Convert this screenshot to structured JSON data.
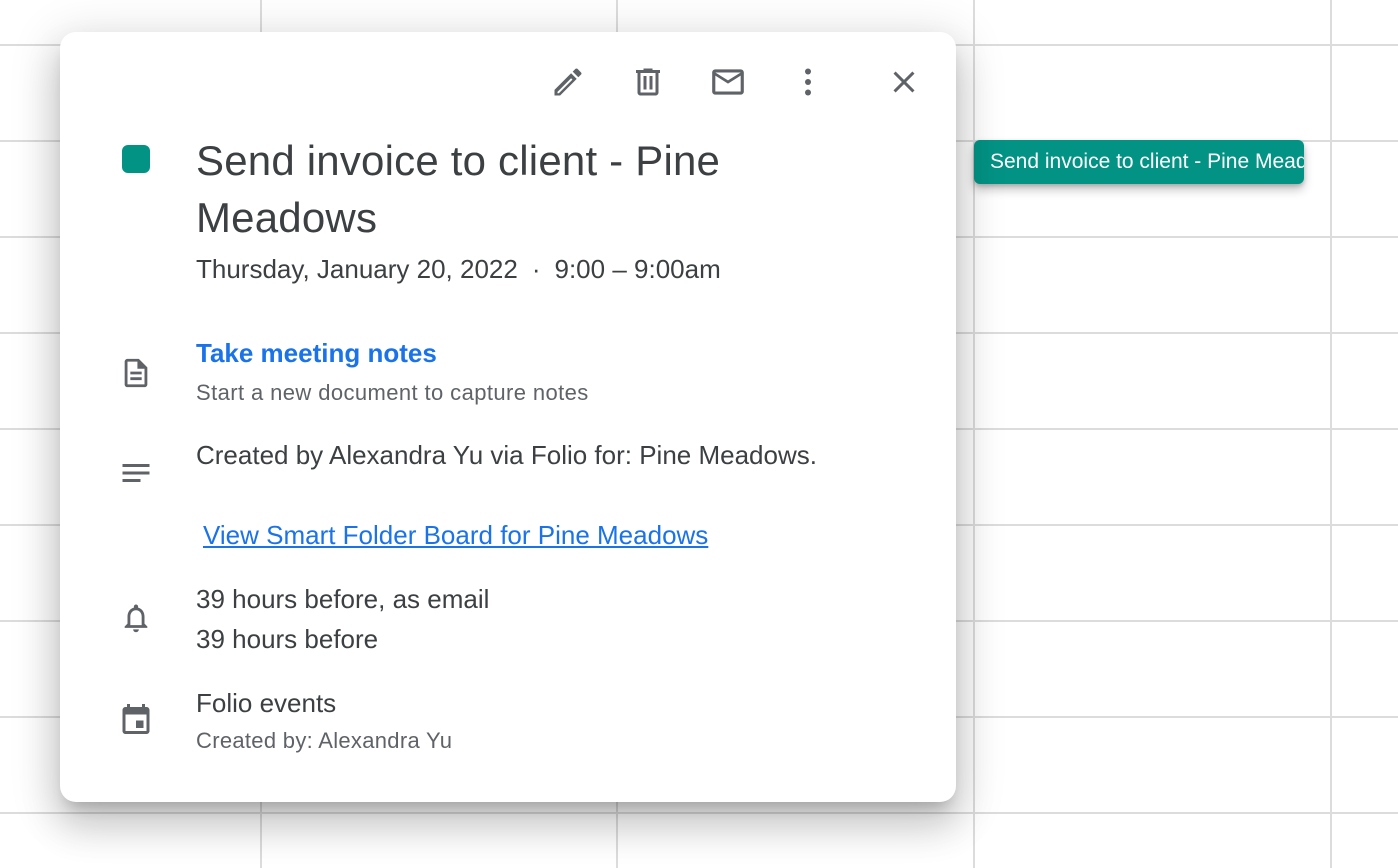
{
  "calendar_event_chip": {
    "label": "Send invoice to client - Pine Meadows"
  },
  "popover": {
    "toolbar": {
      "edit_icon": "pencil-icon",
      "delete_icon": "trash-icon",
      "email_icon": "envelope-icon",
      "options_icon": "vertical-dots-icon",
      "close_icon": "close-icon"
    },
    "event": {
      "color": "#039385",
      "title": "Send invoice to client - Pine Meadows",
      "date": "Thursday, January 20, 2022",
      "separator": "·",
      "time": "9:00 – 9:00am"
    },
    "meeting_notes": {
      "icon": "document-icon",
      "title": "Take meeting notes",
      "subtitle": "Start a new document to capture notes"
    },
    "description": {
      "icon": "notes-lines-icon",
      "text": "Created by Alexandra Yu via Folio for: Pine Meadows.",
      "link": "View Smart Folder Board for Pine Meadows"
    },
    "reminders": {
      "icon": "bell-icon",
      "items": [
        "39 hours before, as email",
        "39 hours before"
      ]
    },
    "calendar": {
      "icon": "calendar-icon",
      "name": "Folio events",
      "creator": "Created by: Alexandra Yu"
    }
  },
  "colors": {
    "accent": "#039385",
    "link": "#1a73e8",
    "text": "#3c4043",
    "secondary_text": "#5f6368",
    "grid": "#dcdcdc"
  }
}
